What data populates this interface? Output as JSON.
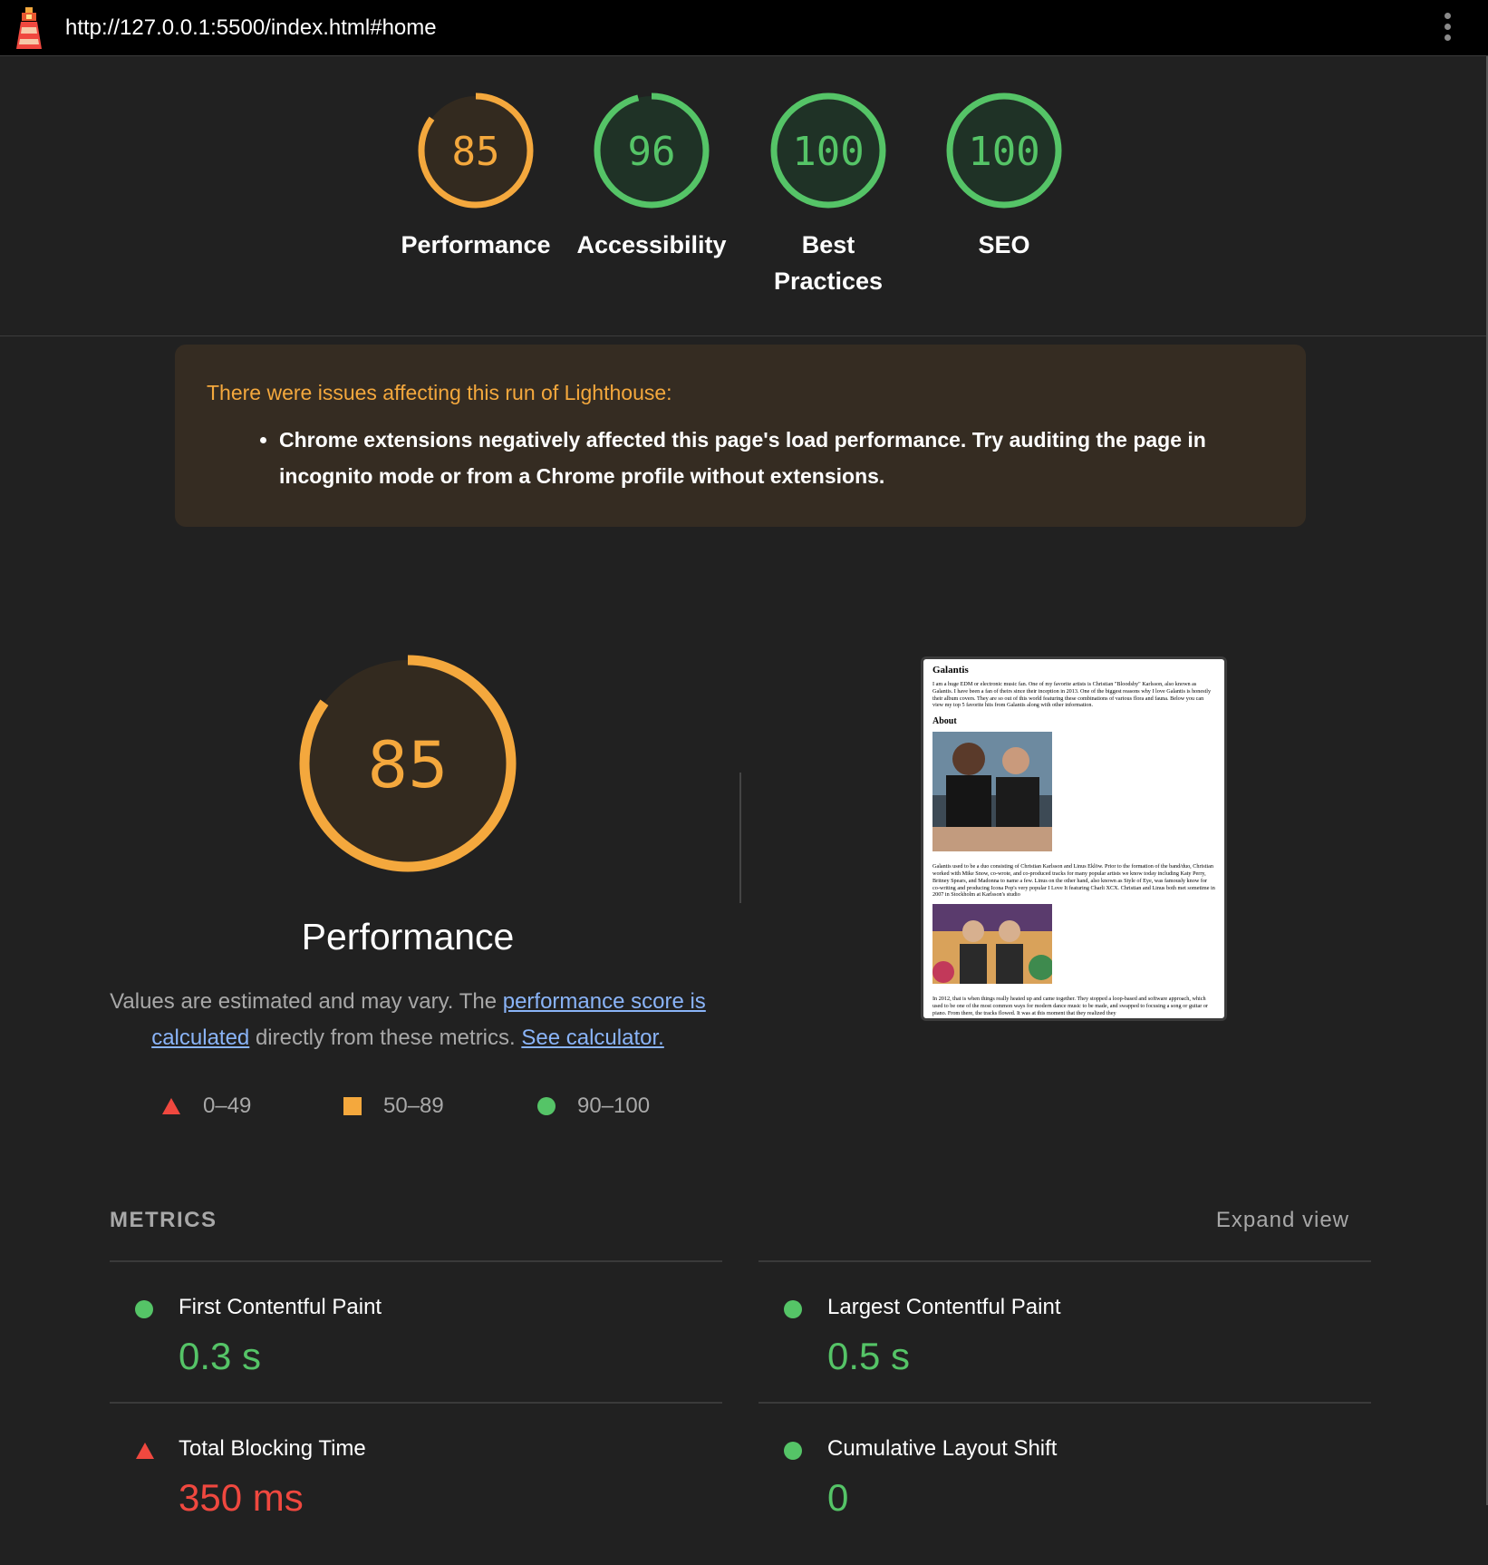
{
  "browser": {
    "url": "http://127.0.0.1:5500/index.html#home",
    "menu_icon": "kebab-menu-icon",
    "logo_icon": "lighthouse-icon"
  },
  "categories": [
    {
      "score": "85",
      "label": "Performance",
      "status": "average",
      "fraction": 0.85
    },
    {
      "score": "96",
      "label": "Accessibility",
      "status": "pass",
      "fraction": 0.96
    },
    {
      "score": "100",
      "label": "Best Practices",
      "status": "pass",
      "fraction": 1.0
    },
    {
      "score": "100",
      "label": "SEO",
      "status": "pass",
      "fraction": 1.0
    }
  ],
  "warning": {
    "title": "There were issues affecting this run of Lighthouse:",
    "items": [
      "Chrome extensions negatively affected this page's load performance. Try auditing the page in incognito mode or from a Chrome profile without extensions."
    ]
  },
  "performance": {
    "score": "85",
    "fraction": 0.85,
    "title": "Performance",
    "desc_prefix": "Values are estimated and may vary. The ",
    "link1": "performance score is calculated",
    "desc_middle": " directly from these metrics. ",
    "link2": "See calculator.",
    "legend": [
      "0–49",
      "50–89",
      "90–100"
    ]
  },
  "screenshot": {
    "heading": "Galantis",
    "para1": "I am a huge EDM or electronic music fan. One of my favorite artists is Christian \"Bloodshy\" Karlsson, also known as Galantis. I have been a fan of theirs since their inception in 2013. One of the biggest reasons why I love Galantis is honestly their album covers. They are so out of this world featuring these combinations of various flora and fauna. Below you can view my top 5 favorite hits from Galantis along with other information.",
    "about": "About",
    "para2": "Galantis used to be a duo consisting of Christian Karlsson and Linus Eklöw. Prior to the formation of the band/duo, Christian worked with Mike Snow, co-wrote, and co-produced tracks for many popular artists we know today including Katy Perry, Britney Spears, and Madonna to name a few. Linus on the other hand, also known as Style of Eye, was famously know for co-writing and producing Icona Pop's very popular I Love It featuring Charli XCX. Christian and Linus both met sometime in 2007 in Stockholm at Karlsson's studio",
    "para3": "In 2012, that is when things really heated up and came together. They stopped a loop-based and software approach, which used to be one of the most common ways for modern dance music to be made, and swapped to focusing a song or guitar or piano. From there, the tracks flowed. It was at this moment that they realized they"
  },
  "metrics": {
    "title": "METRICS",
    "expand": "Expand view",
    "items": [
      {
        "name": "First Contentful Paint",
        "value": "0.3 s",
        "status": "pass"
      },
      {
        "name": "Largest Contentful Paint",
        "value": "0.5 s",
        "status": "pass"
      },
      {
        "name": "Total Blocking Time",
        "value": "350 ms",
        "status": "fail"
      },
      {
        "name": "Cumulative Layout Shift",
        "value": "0",
        "status": "pass"
      }
    ]
  },
  "colors": {
    "pass": "#55c467",
    "average": "#f4a83d",
    "fail": "#f0483f",
    "pass_bg": "#1f3226",
    "average_bg": "#332a1f"
  }
}
